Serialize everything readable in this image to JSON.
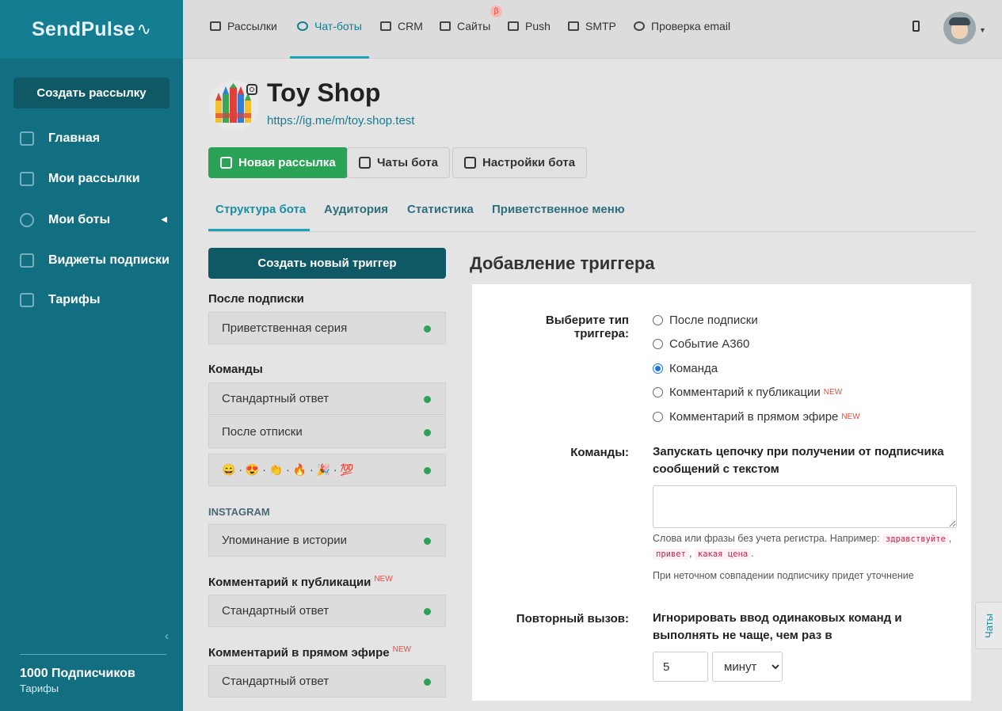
{
  "brand": {
    "logo_text": "SendPulse",
    "logo_mark": "∿"
  },
  "sidebar": {
    "create_button": "Создать рассылку",
    "items": [
      {
        "label": "Главная",
        "icon": "dashboard-icon"
      },
      {
        "label": "Мои рассылки",
        "icon": "mailings-icon"
      },
      {
        "label": "Мои боты",
        "icon": "globe-icon"
      },
      {
        "label": "Виджеты подписки",
        "icon": "widget-icon"
      },
      {
        "label": "Тарифы",
        "icon": "wallet-icon"
      }
    ],
    "subscribers": "1000 Подписчиков",
    "plan": "Тарифы"
  },
  "topnav": {
    "items": [
      {
        "label": "Рассылки",
        "icon": "mail-icon"
      },
      {
        "label": "Чат-боты",
        "icon": "chatbot-icon",
        "active": true
      },
      {
        "label": "CRM",
        "icon": "crm-icon"
      },
      {
        "label": "Сайты",
        "icon": "sites-icon"
      },
      {
        "label": "Push",
        "icon": "bell-icon"
      },
      {
        "label": "SMTP",
        "icon": "code-icon"
      },
      {
        "label": "Проверка email",
        "icon": "check-circle-icon"
      }
    ],
    "beta_badge": "β"
  },
  "bot": {
    "name": "Toy Shop",
    "link": "https://ig.me/m/toy.shop.test",
    "buttons": {
      "new_mailing": "Новая рассылка",
      "bot_chats": "Чаты бота",
      "bot_settings": "Настройки бота"
    },
    "tabs": [
      "Структура бота",
      "Аудитория",
      "Статистика",
      "Приветственное меню"
    ]
  },
  "triggers": {
    "create_button": "Создать новый триггер",
    "sections": {
      "after_subscribe": "После подписки",
      "commands": "Команды",
      "instagram": "INSTAGRAM",
      "post_comment": "Комментарий к публикации",
      "live_comment": "Комментарий в прямом эфире",
      "new_badge": "NEW"
    },
    "items": {
      "welcome": "Приветственная серия",
      "standard1": "Стандартный ответ",
      "unsubscribe": "После отписки",
      "emoji": "😄 · 😍 · 👏 · 🔥 · 🎉 · 💯",
      "story_mention": "Упоминание в истории",
      "standard2": "Стандартный ответ",
      "standard3": "Стандартный ответ"
    },
    "status_color": "#2aa357"
  },
  "form": {
    "title": "Добавление триггера",
    "type_label": "Выберите тип триггера:",
    "options": [
      {
        "label": "После подписки",
        "checked": false,
        "new": false
      },
      {
        "label": "Событие А360",
        "checked": false,
        "new": false
      },
      {
        "label": "Команда",
        "checked": true,
        "new": false
      },
      {
        "label": "Комментарий к публикации",
        "checked": false,
        "new": true
      },
      {
        "label": "Комментарий в прямом эфире",
        "checked": false,
        "new": true
      }
    ],
    "new_badge": "NEW",
    "commands_label": "Команды:",
    "commands_desc": "Запускать цепочку при получении от подписчика сообщений с текстом",
    "commands_value": "",
    "hint_prefix": "Слова или фразы без учета регистра. Например:",
    "hint_examples": [
      "здравствуйте",
      "привет",
      "какая цена"
    ],
    "hint_note": "При неточном совпадении подписчику придет уточнение",
    "repeat_label": "Повторный вызов:",
    "repeat_desc": "Игнорировать ввод одинаковых команд и выполнять не чаще, чем раз в",
    "repeat_value": "5",
    "repeat_unit": "минут"
  },
  "chats_tab": "Чаты"
}
